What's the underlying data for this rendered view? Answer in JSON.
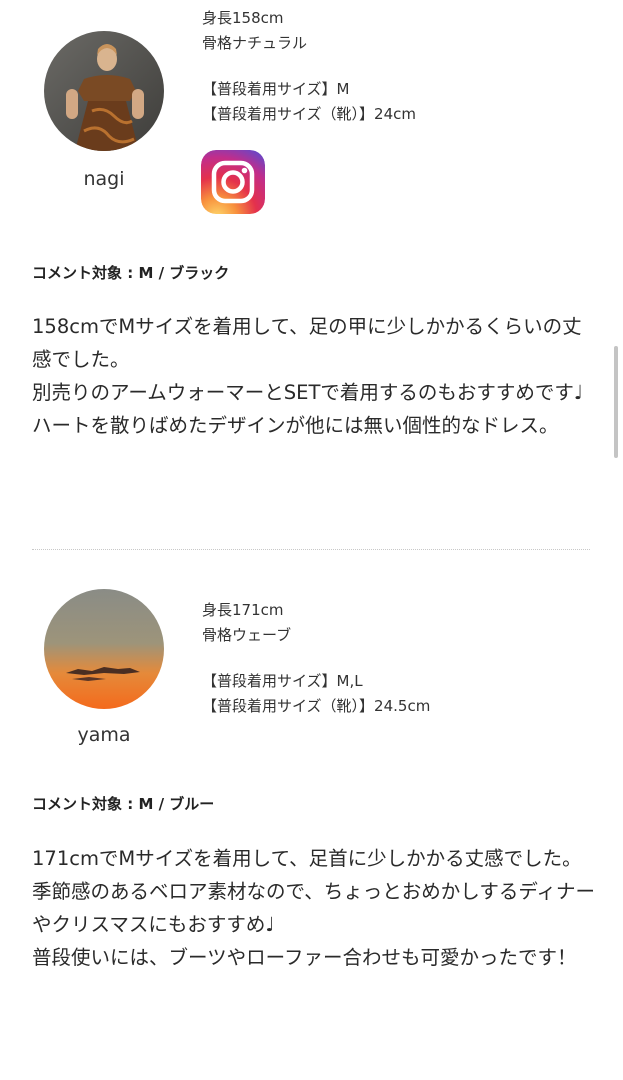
{
  "reviews": [
    {
      "username": "nagi",
      "height": "身長158cm",
      "frame_type": "骨格ナチュラル",
      "usual_size": "【普段着用サイズ】M",
      "usual_shoe_size": "【普段着用サイズ（靴）】24cm",
      "has_instagram": true,
      "comment_target": "コメント対象 : M / ブラック",
      "comment": "158cmでMサイズを着用して、足の甲に少しかかるくらいの丈感でした。\n別売りのアームウォーマーとSETで着用するのもおすすめです♩\nハートを散りばめたデザインが他には無い個性的なドレス。"
    },
    {
      "username": "yama",
      "height": "身長171cm",
      "frame_type": "骨格ウェーブ",
      "usual_size": "【普段着用サイズ】M,L",
      "usual_shoe_size": "【普段着用サイズ（靴）】24.5cm",
      "has_instagram": false,
      "comment_target": "コメント対象 : M / ブルー",
      "comment": "171cmでMサイズを着用して、足首に少しかかる丈感でした。\n季節感のあるベロア素材なので、ちょっとおめかしするディナーやクリスマスにもおすすめ♩\n普段使いには、ブーツやローファー合わせも可愛かったです！"
    }
  ],
  "icons": {
    "instagram": "instagram-icon"
  },
  "colors": {
    "text": "#2a2a2a",
    "divider": "#c8c8c8",
    "scrollbar": "#c4c4c4"
  }
}
